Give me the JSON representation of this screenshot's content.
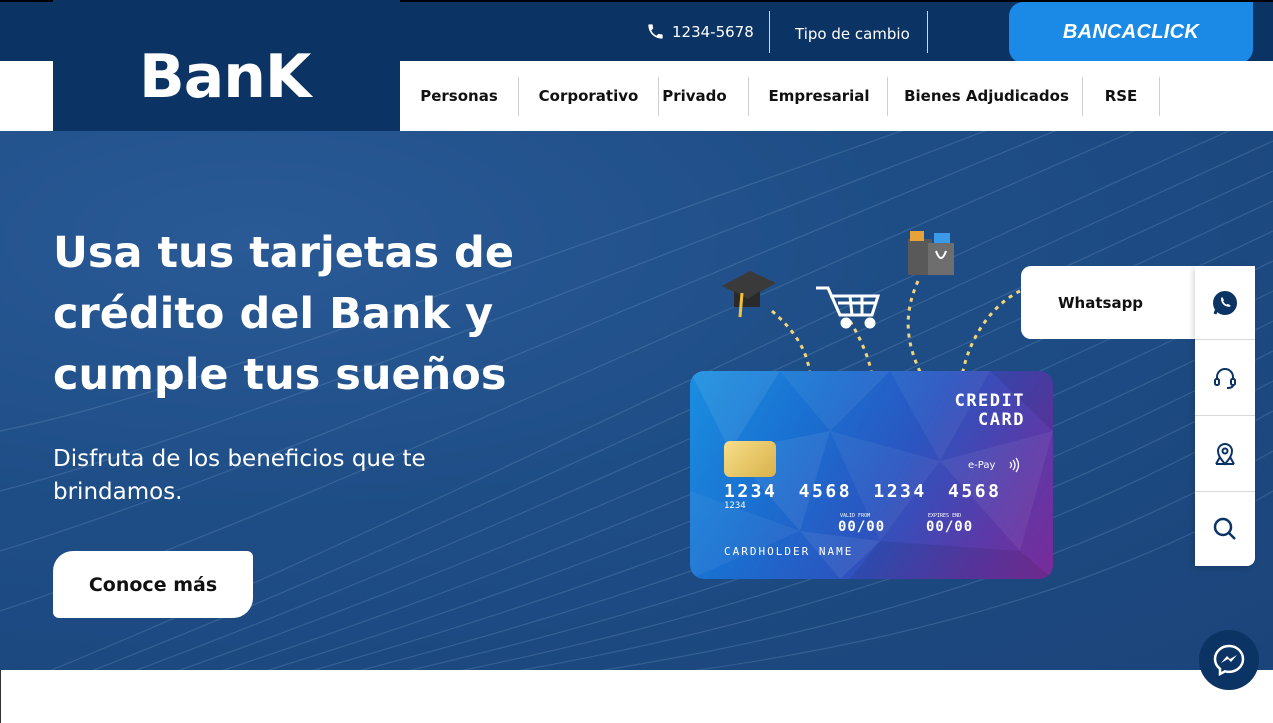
{
  "topbar": {
    "phone": "1234-5678",
    "exchange_link": "Tipo de cambio",
    "bancaclick": "BANCACLICK"
  },
  "logo": "BanK",
  "nav": {
    "items": [
      {
        "label": "Personas"
      },
      {
        "label": "Corporativo"
      },
      {
        "label": "Privado"
      },
      {
        "label": "Empresarial"
      },
      {
        "label": "Bienes Adjudicados"
      },
      {
        "label": "RSE"
      }
    ]
  },
  "hero": {
    "headline": "Usa tus tarjetas de crédito del Bank y cumple tus sueños",
    "subline": "Disfruta de los beneficios que te brindamos.",
    "cta": "Conoce más"
  },
  "card": {
    "title_line1": "CREDIT",
    "title_line2": "CARD",
    "epay": "e-Pay",
    "number": "1234 4568 1234 4568",
    "number_small": "1234",
    "valid_from_label": "VALID FROM",
    "valid_from": "00/00",
    "expires_label": "EXPIRES END",
    "expires": "00/00",
    "holder": "CARDHOLDER NAME"
  },
  "side": {
    "whatsapp": "Whatsapp"
  },
  "icons": {
    "phone": "phone-icon",
    "whatsapp": "whatsapp-icon",
    "support": "headset-icon",
    "location": "map-pin-icon",
    "search": "search-icon",
    "messenger": "messenger-icon"
  },
  "colors": {
    "navy": "#0b3363",
    "accent": "#1a8ae6",
    "hero": "#1e4d86"
  }
}
